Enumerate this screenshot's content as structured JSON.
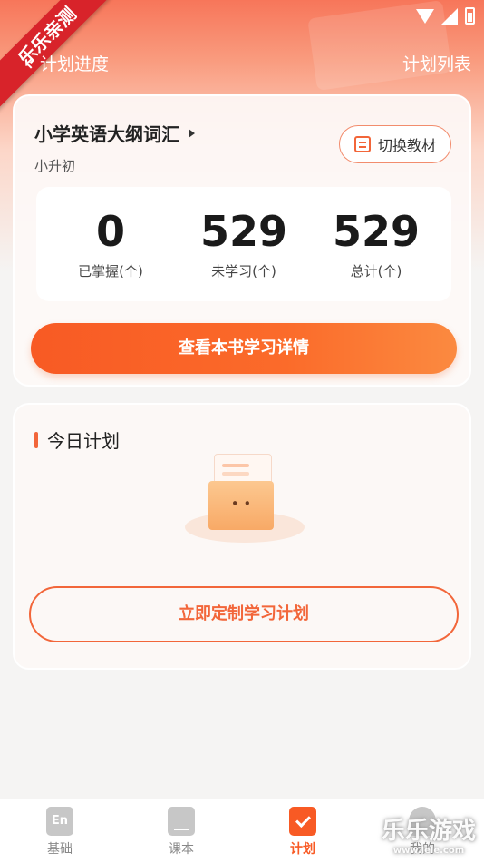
{
  "watermark": {
    "ribbon": "乐乐亲测",
    "corner": "乐乐游戏",
    "corner_url": "www.lele.com"
  },
  "header": {
    "back_label": "计划进度",
    "list_label": "计划列表"
  },
  "book": {
    "title": "小学英语大纲词汇",
    "level": "小升初",
    "switch_label": "切换教材",
    "stats": [
      {
        "value": "0",
        "label": "已掌握(个)"
      },
      {
        "value": "529",
        "label": "未学习(个)"
      },
      {
        "value": "529",
        "label": "总计(个)"
      }
    ],
    "detail_button": "查看本书学习详情"
  },
  "plan": {
    "title": "今日计划",
    "empty_face": "• •",
    "create_button": "立即定制学习计划"
  },
  "nav": {
    "items": [
      {
        "label": "基础",
        "icon": "En"
      },
      {
        "label": "课本",
        "icon": ""
      },
      {
        "label": "计划",
        "icon": ""
      },
      {
        "label": "我的",
        "icon": ""
      }
    ],
    "active_index": 2
  },
  "colors": {
    "accent": "#f85a24",
    "accent_light": "#fb8a40",
    "text_dark": "#222222"
  }
}
